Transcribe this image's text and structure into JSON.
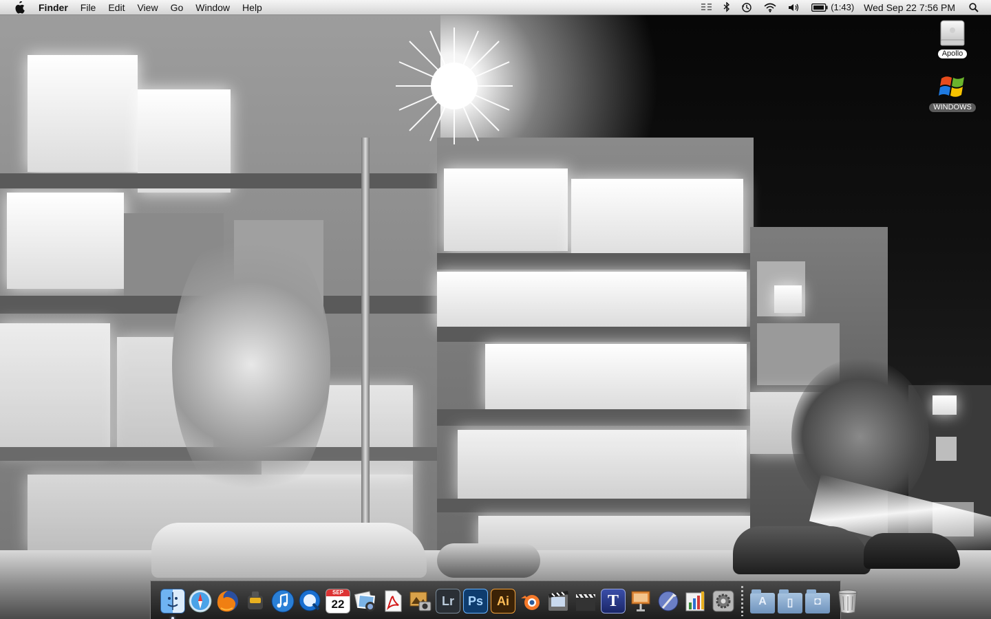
{
  "menubar": {
    "app_name": "Finder",
    "menus": [
      "File",
      "Edit",
      "View",
      "Go",
      "Window",
      "Help"
    ],
    "status_icons": [
      "spaces-icon",
      "bluetooth-icon",
      "time-machine-icon",
      "wifi-icon",
      "volume-icon",
      "battery-icon"
    ],
    "battery_time": "(1:43)",
    "clock": "Wed Sep 22  7:56 PM"
  },
  "desktop": {
    "icons": [
      {
        "label": "Apollo",
        "icon": "hard-drive-icon"
      },
      {
        "label": "WINDOWS",
        "icon": "windows-drive-icon"
      }
    ]
  },
  "dock": {
    "apps": [
      {
        "name": "Finder",
        "icon": "finder-icon",
        "running": true
      },
      {
        "name": "Safari",
        "icon": "safari-icon",
        "running": false
      },
      {
        "name": "Firefox",
        "icon": "firefox-icon",
        "running": false
      },
      {
        "name": "Transmission",
        "icon": "transmission-icon",
        "running": false
      },
      {
        "name": "iTunes",
        "icon": "itunes-icon",
        "running": false
      },
      {
        "name": "QuickTime",
        "icon": "quicktime-icon",
        "running": false
      },
      {
        "name": "iCal",
        "icon": "ical-icon",
        "date_badge": "22",
        "month_badge": "SEP",
        "running": false
      },
      {
        "name": "iPhoto",
        "icon": "iphoto-icon",
        "running": false
      },
      {
        "name": "Acrobat",
        "icon": "acrobat-icon",
        "running": false
      },
      {
        "name": "Image Capture",
        "icon": "image-capture-icon",
        "running": false
      },
      {
        "name": "Lightroom",
        "icon": "lightroom-icon",
        "glyph": "Lr",
        "running": false
      },
      {
        "name": "Photoshop",
        "icon": "photoshop-icon",
        "glyph": "Ps",
        "running": false
      },
      {
        "name": "Illustrator",
        "icon": "illustrator-icon",
        "glyph": "Ai",
        "running": false
      },
      {
        "name": "Blender",
        "icon": "blender-icon",
        "running": false
      },
      {
        "name": "iMovie",
        "icon": "imovie-icon",
        "running": false
      },
      {
        "name": "Final Cut",
        "icon": "clapper-icon",
        "running": false
      },
      {
        "name": "Typeset",
        "icon": "typeset-icon",
        "glyph": "T",
        "running": false
      },
      {
        "name": "Keynote",
        "icon": "keynote-icon",
        "running": false
      },
      {
        "name": "Script Editor",
        "icon": "script-editor-icon",
        "running": false
      },
      {
        "name": "Grapher",
        "icon": "grapher-icon",
        "running": false
      },
      {
        "name": "System Preferences",
        "icon": "system-preferences-icon",
        "running": false
      }
    ],
    "stacks": [
      {
        "name": "Applications",
        "icon": "applications-folder-icon",
        "glyph": "A"
      },
      {
        "name": "Documents",
        "icon": "documents-folder-icon",
        "glyph": "▯"
      },
      {
        "name": "Pictures",
        "icon": "pictures-folder-icon",
        "glyph": "◘"
      }
    ],
    "trash": {
      "name": "Trash",
      "icon": "trash-icon"
    }
  }
}
